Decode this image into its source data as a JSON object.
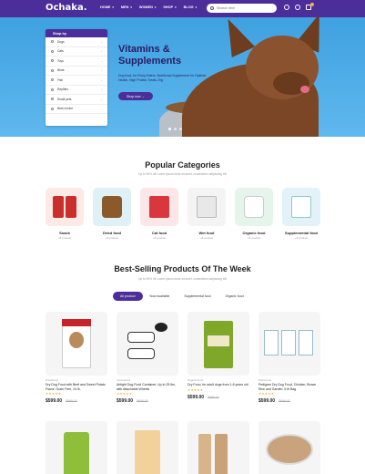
{
  "header": {
    "logo": "Ochaka.",
    "nav": [
      "HOME",
      "MEN",
      "WOMEN",
      "SHOP",
      "BLOG"
    ],
    "search_placeholder": "Search item",
    "cart_count": "0"
  },
  "hero": {
    "title_line1": "Vitamins &",
    "title_line2": "Supplements",
    "subtitle": "Dog food; for Picky Eaters, Nutritional Supplement for Optimal Health, High Protein Treats 20g",
    "button": "Shop now →"
  },
  "shop_by": {
    "title": "Shop by",
    "items": [
      "Dogs",
      "Cats",
      "Toys",
      "Birds",
      "Fish",
      "Reptiles",
      "Small pets",
      "Best choice"
    ]
  },
  "popular": {
    "title": "Popular Categories",
    "subtitle": "Up to 50% off Lorem ipsum dolor sit amet, consectetur adipiscing elit",
    "categories": [
      {
        "name": "Snack",
        "count": "+8 product"
      },
      {
        "name": "Dried food",
        "count": "+8 product"
      },
      {
        "name": "Cat food",
        "count": "+8 product"
      },
      {
        "name": "Wet food",
        "count": "+8 product"
      },
      {
        "name": "Organic food",
        "count": "+8 product"
      },
      {
        "name": "Supplemental food",
        "count": "+8 product"
      }
    ]
  },
  "bestsellers": {
    "title": "Best-Selling Products Of The Week",
    "subtitle": "Up to 50% off Lorem ipsum dolor sit amet, consectetur adipiscing elit",
    "tabs": [
      "All product",
      "Now available",
      "Supplemental food",
      "Organic food"
    ],
    "products": [
      {
        "category": "Dried Food",
        "name": "Dry Dog Food with Beef and Sweet Potato Flavor, Grain Free, 24 lb.",
        "stars": "★★★★★",
        "price": "$599.00",
        "old_price": "$899.00"
      },
      {
        "category": "Accessories",
        "name": "Airtight Dog Food Container, Up to 25 lbs, with Attachable Wheels",
        "stars": "★★★★★",
        "price": "$599.00",
        "old_price": "$899.00"
      },
      {
        "category": "Organic Food",
        "name": "Dry Food, for adult dogs from 1-6 years old",
        "stars": "★★★★★",
        "price": "$599.00",
        "old_price": "$899.00"
      },
      {
        "category": "Dried Food",
        "name": "Pedigree Dry Dog Food, Chicken, Brown Rice and Garden, 5 lb Bag",
        "stars": "★★★★★",
        "price": "$599.00",
        "old_price": "$899.00"
      }
    ]
  },
  "colors": {
    "brand": "#4b2e9a",
    "accent": "#f5a623",
    "hero_bg": "#4aa9e6"
  }
}
